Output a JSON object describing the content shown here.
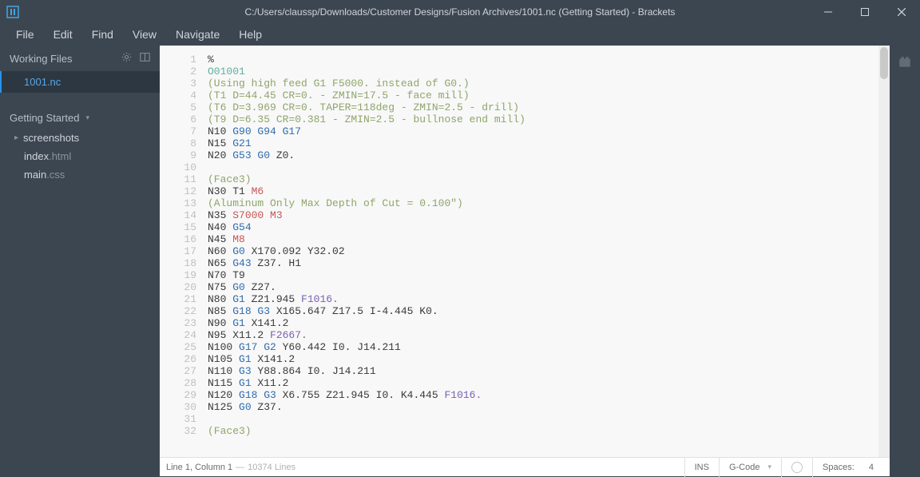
{
  "window": {
    "title": "C:/Users/claussp/Downloads/Customer Designs/Fusion Archives/1001.nc (Getting Started) - Brackets"
  },
  "menu": {
    "items": [
      "File",
      "Edit",
      "Find",
      "View",
      "Navigate",
      "Help"
    ]
  },
  "sidebar": {
    "workingFilesLabel": "Working Files",
    "workingFiles": [
      "1001.nc"
    ],
    "projectName": "Getting Started",
    "folders": [
      "screenshots"
    ],
    "projectFiles": [
      {
        "name": "index",
        "ext": ".html"
      },
      {
        "name": "main",
        "ext": ".css"
      }
    ]
  },
  "status": {
    "cursor": "Line 1, Column 1",
    "lines": "10374 Lines",
    "ins": "INS",
    "language": "G-Code",
    "spacesLabel": "Spaces:",
    "spacesValue": "4"
  },
  "code": [
    [
      {
        "c": "n",
        "t": "%"
      }
    ],
    [
      {
        "c": "prog",
        "t": "O01001"
      }
    ],
    [
      {
        "c": "comment",
        "t": "(Using high feed G1 F5000. instead of G0.)"
      }
    ],
    [
      {
        "c": "comment",
        "t": "(T1 D=44.45 CR=0. - ZMIN=17.5 - face mill)"
      }
    ],
    [
      {
        "c": "comment",
        "t": "(T6 D=3.969 CR=0. TAPER=118deg - ZMIN=2.5 - drill)"
      }
    ],
    [
      {
        "c": "comment",
        "t": "(T9 D=6.35 CR=0.381 - ZMIN=2.5 - bullnose end mill)"
      }
    ],
    [
      {
        "c": "n",
        "t": "N10 "
      },
      {
        "c": "g",
        "t": "G90 G94 G17"
      }
    ],
    [
      {
        "c": "n",
        "t": "N15 "
      },
      {
        "c": "g",
        "t": "G21"
      }
    ],
    [
      {
        "c": "n",
        "t": "N20 "
      },
      {
        "c": "g",
        "t": "G53 G0"
      },
      {
        "c": "xyz",
        "t": " Z0."
      }
    ],
    [],
    [
      {
        "c": "comment",
        "t": "(Face3)"
      }
    ],
    [
      {
        "c": "n",
        "t": "N30 T1 "
      },
      {
        "c": "m",
        "t": "M6"
      }
    ],
    [
      {
        "c": "comment",
        "t": "(Aluminum Only Max Depth of Cut = 0.100\")"
      }
    ],
    [
      {
        "c": "n",
        "t": "N35 "
      },
      {
        "c": "s",
        "t": "S7000"
      },
      {
        "c": "n",
        "t": " "
      },
      {
        "c": "m",
        "t": "M3"
      }
    ],
    [
      {
        "c": "n",
        "t": "N40 "
      },
      {
        "c": "g",
        "t": "G54"
      }
    ],
    [
      {
        "c": "n",
        "t": "N45 "
      },
      {
        "c": "m",
        "t": "M8"
      }
    ],
    [
      {
        "c": "n",
        "t": "N60 "
      },
      {
        "c": "g",
        "t": "G0"
      },
      {
        "c": "xyz",
        "t": " X170.092 Y32.02"
      }
    ],
    [
      {
        "c": "n",
        "t": "N65 "
      },
      {
        "c": "g",
        "t": "G43"
      },
      {
        "c": "xyz",
        "t": " Z37. H1"
      }
    ],
    [
      {
        "c": "n",
        "t": "N70 T9"
      }
    ],
    [
      {
        "c": "n",
        "t": "N75 "
      },
      {
        "c": "g",
        "t": "G0"
      },
      {
        "c": "xyz",
        "t": " Z27."
      }
    ],
    [
      {
        "c": "n",
        "t": "N80 "
      },
      {
        "c": "g",
        "t": "G1"
      },
      {
        "c": "xyz",
        "t": " Z21.945 "
      },
      {
        "c": "f",
        "t": "F1016."
      }
    ],
    [
      {
        "c": "n",
        "t": "N85 "
      },
      {
        "c": "g",
        "t": "G18 G3"
      },
      {
        "c": "xyz",
        "t": " X165.647 Z17.5 I-4.445 K0."
      }
    ],
    [
      {
        "c": "n",
        "t": "N90 "
      },
      {
        "c": "g",
        "t": "G1"
      },
      {
        "c": "xyz",
        "t": " X141.2"
      }
    ],
    [
      {
        "c": "n",
        "t": "N95 "
      },
      {
        "c": "xyz",
        "t": "X11.2 "
      },
      {
        "c": "f",
        "t": "F2667."
      }
    ],
    [
      {
        "c": "n",
        "t": "N100 "
      },
      {
        "c": "g",
        "t": "G17 G2"
      },
      {
        "c": "xyz",
        "t": " Y60.442 I0. J14.211"
      }
    ],
    [
      {
        "c": "n",
        "t": "N105 "
      },
      {
        "c": "g",
        "t": "G1"
      },
      {
        "c": "xyz",
        "t": " X141.2"
      }
    ],
    [
      {
        "c": "n",
        "t": "N110 "
      },
      {
        "c": "g",
        "t": "G3"
      },
      {
        "c": "xyz",
        "t": " Y88.864 I0. J14.211"
      }
    ],
    [
      {
        "c": "n",
        "t": "N115 "
      },
      {
        "c": "g",
        "t": "G1"
      },
      {
        "c": "xyz",
        "t": " X11.2"
      }
    ],
    [
      {
        "c": "n",
        "t": "N120 "
      },
      {
        "c": "g",
        "t": "G18 G3"
      },
      {
        "c": "xyz",
        "t": " X6.755 Z21.945 I0. K4.445 "
      },
      {
        "c": "f",
        "t": "F1016."
      }
    ],
    [
      {
        "c": "n",
        "t": "N125 "
      },
      {
        "c": "g",
        "t": "G0"
      },
      {
        "c": "xyz",
        "t": " Z37."
      }
    ],
    [],
    [
      {
        "c": "comment",
        "t": "(Face3)"
      }
    ]
  ]
}
